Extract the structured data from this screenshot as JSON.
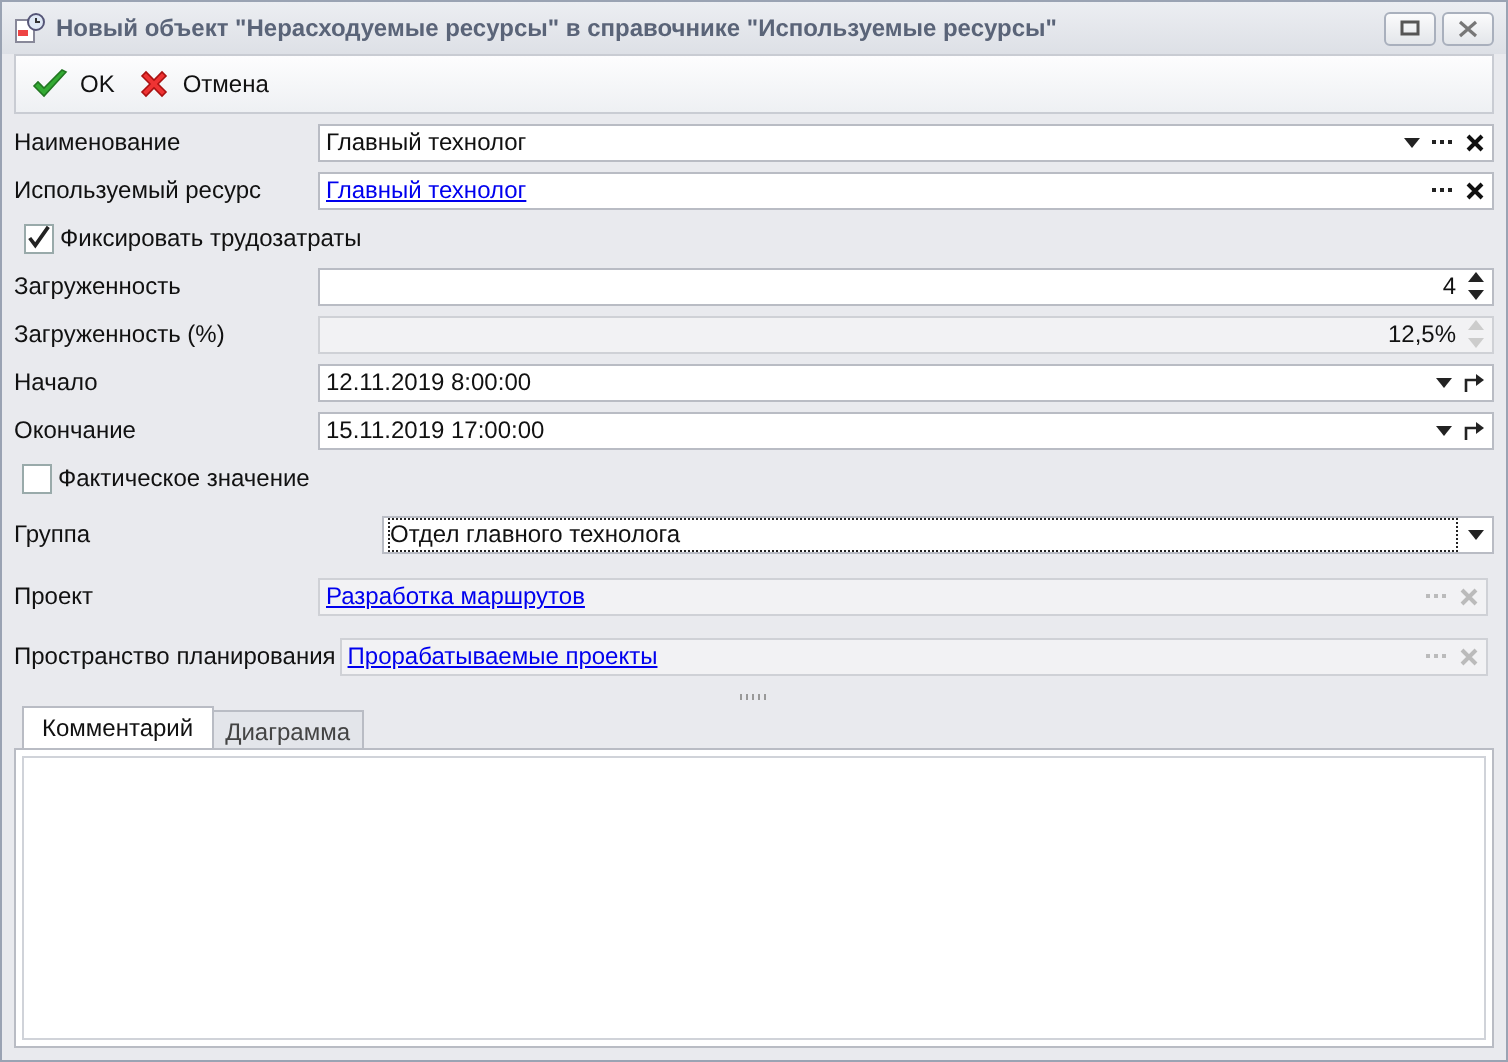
{
  "window": {
    "title": "Новый объект \"Нерасходуемые ресурсы\" в справочнике \"Используемые ресурсы\""
  },
  "toolbar": [
    {
      "kind": "ok",
      "label": "OK"
    },
    {
      "kind": "cancel",
      "label": "Отмена"
    }
  ],
  "rows": [
    {
      "kind": "text",
      "label": "Наименование",
      "value": "Главный технолог",
      "disabled": false,
      "focused": false,
      "buttons": [
        {
          "kind": "dropdown"
        },
        {
          "kind": "ellipsis"
        },
        {
          "kind": "clear"
        }
      ]
    },
    {
      "kind": "link",
      "label": "Используемый ресурс",
      "value": "Главный технолог",
      "disabled": false,
      "focused": false,
      "buttons": [
        {
          "kind": "ellipsis"
        },
        {
          "kind": "clear"
        }
      ]
    },
    {
      "kind": "checkbox",
      "label": "Фиксировать трудозатраты",
      "checked": true
    },
    {
      "kind": "number",
      "label": "Загруженность",
      "value": "4",
      "disabled": false,
      "focused": false,
      "buttons": [
        {
          "kind": "spin"
        }
      ]
    },
    {
      "kind": "number",
      "label": "Загруженность (%)",
      "value": "12,5%",
      "disabled": true,
      "focused": false,
      "buttons": [
        {
          "kind": "spin"
        }
      ]
    },
    {
      "kind": "text",
      "label": "Начало",
      "value": "12.11.2019 8:00:00",
      "disabled": false,
      "focused": false,
      "buttons": [
        {
          "kind": "dropdown"
        },
        {
          "kind": "goto"
        }
      ]
    },
    {
      "kind": "text",
      "label": "Окончание",
      "value": "15.11.2019 17:00:00",
      "disabled": false,
      "focused": false,
      "buttons": [
        {
          "kind": "dropdown"
        },
        {
          "kind": "goto"
        }
      ]
    },
    {
      "kind": "checkbox",
      "label": "Фактическое значение",
      "checked": false
    },
    {
      "kind": "group_text",
      "label": "Группа",
      "value": "Отдел главного технолога",
      "disabled": false,
      "focused": true,
      "buttons": [
        {
          "kind": "dropdown"
        }
      ]
    },
    {
      "kind": "group_link",
      "label": "Проект",
      "value": "Разработка маршрутов",
      "disabled": true,
      "focused": false,
      "buttons": [
        {
          "kind": "ellipsis"
        },
        {
          "kind": "clear"
        }
      ]
    },
    {
      "kind": "group_link",
      "label": "Пространство планирования",
      "value": "Прорабатываемые проекты",
      "disabled": true,
      "focused": false,
      "buttons": [
        {
          "kind": "ellipsis"
        },
        {
          "kind": "clear"
        }
      ]
    }
  ],
  "tabs": [
    {
      "label": "Комментарий",
      "selected": true
    },
    {
      "label": "Диаграмма",
      "selected": false
    }
  ]
}
